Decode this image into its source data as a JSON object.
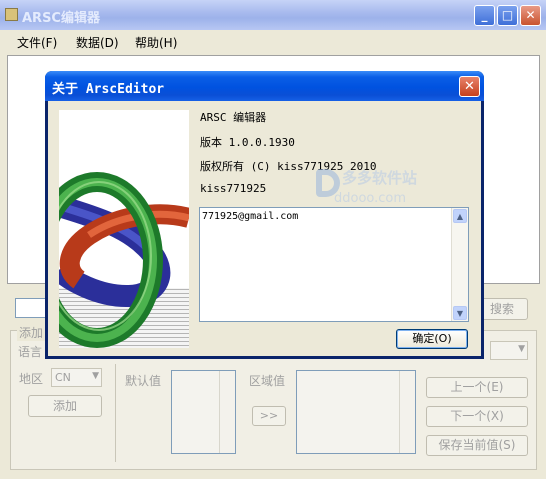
{
  "window": {
    "title": "ARSC编辑器",
    "minimize_glyph": "_",
    "maximize_glyph": "□",
    "close_glyph": "✕"
  },
  "menu": {
    "items": [
      {
        "label": "文件(F)"
      },
      {
        "label": "数据(D)"
      },
      {
        "label": "帮助(H)"
      }
    ]
  },
  "background_form": {
    "search_button": "搜索",
    "add_group_label": "添加",
    "language_label": "语言",
    "region_label": "地区",
    "region_value": "CN",
    "add_button": "添加",
    "default_value_label": "默认值",
    "region_value_label": "区域值",
    "transfer_button": ">>",
    "prev_button": "上一个(E)",
    "next_button": "下一个(X)",
    "save_button": "保存当前值(S)"
  },
  "about_dialog": {
    "title": "关于 ArscEditor",
    "close_glyph": "✕",
    "product_name": "ARSC 编辑器",
    "version": "版本 1.0.0.1930",
    "copyright": "版权所有 (C) kiss771925 2010",
    "company": "kiss771925",
    "description": "771925@gmail.com",
    "ok_button": "确定(O)",
    "scroll_up_glyph": "▲",
    "scroll_down_glyph": "▼"
  },
  "watermark": {
    "line1": "多多软件站",
    "line2": "ddooo.com"
  },
  "colors": {
    "title_active": "#0052e0",
    "title_inactive": "#a9bbee",
    "face": "#ece9d8"
  }
}
